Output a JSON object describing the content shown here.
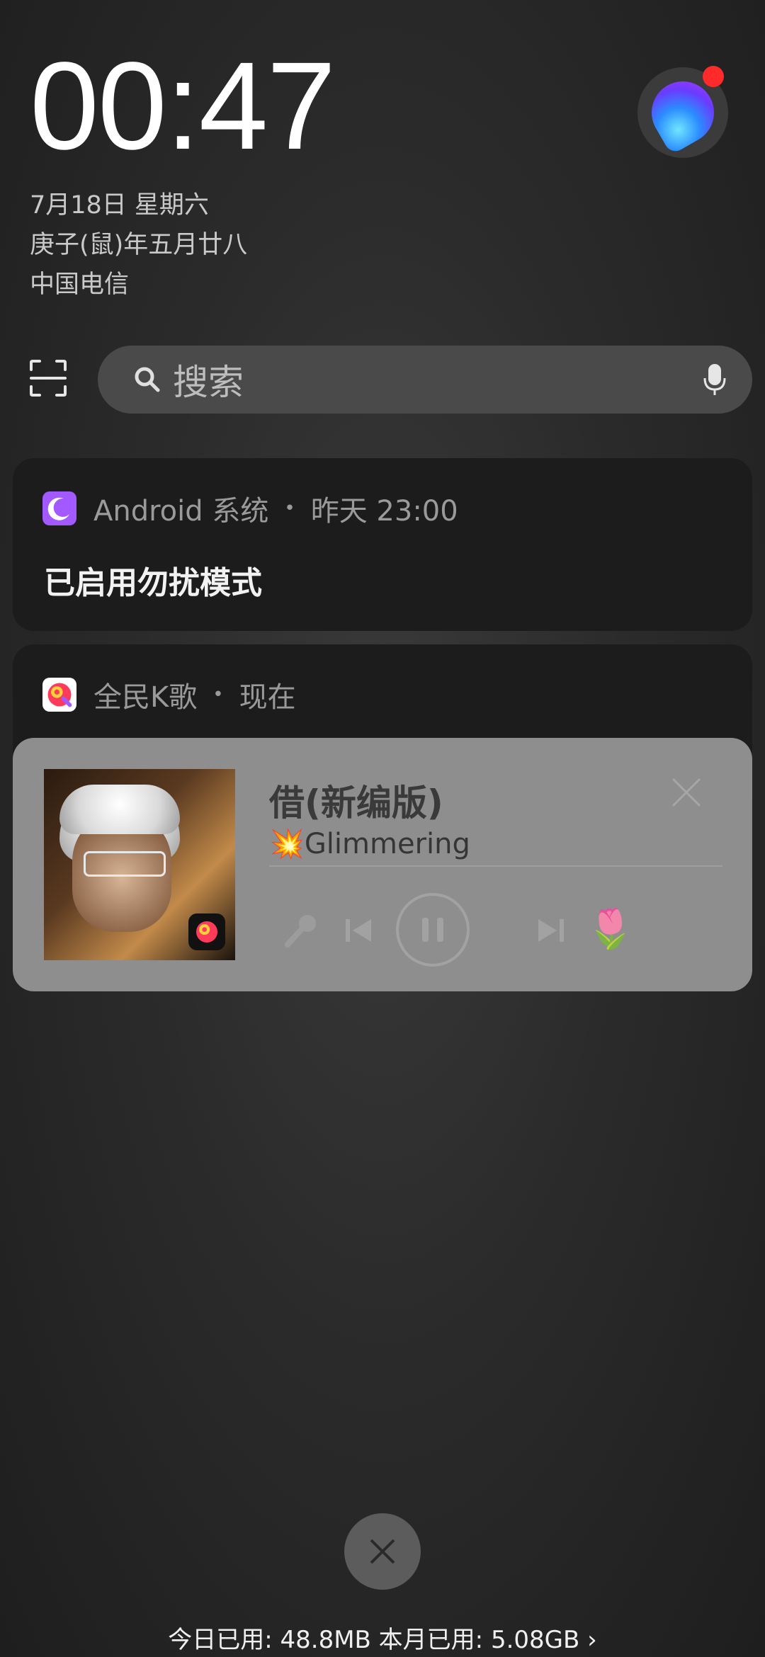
{
  "clock": {
    "time": "00:47"
  },
  "date": {
    "gregorian": "7月18日 星期六",
    "lunar": "庚子(鼠)年五月廿八",
    "carrier": "中国电信"
  },
  "search": {
    "placeholder": "搜索"
  },
  "notification_system": {
    "app": "Android 系统",
    "separator": "•",
    "time": "昨天 23:00",
    "message": "已启用勿扰模式"
  },
  "notification_music": {
    "app": "全民K歌",
    "separator": "•",
    "time": "现在",
    "song_title": "借(新编版)",
    "artist_emoji": "💥",
    "artist": "Glimmering",
    "flower_emoji": "🌷"
  },
  "footer": {
    "data_usage": "今日已用: 48.8MB 本月已用: 5.08GB",
    "chevron": "›"
  },
  "colors": {
    "dnd_icon_bg": "#a259ff",
    "kge_icon_bg": "#ff3b5c",
    "assistant_dot": "#ff2a2a",
    "player_bg": "#8e8e8e"
  },
  "icons": [
    "scan-icon",
    "search-icon",
    "mic-icon",
    "moon-icon",
    "karaoke-app-icon",
    "close-icon",
    "microphone-icon",
    "previous-icon",
    "pause-icon",
    "next-icon"
  ]
}
